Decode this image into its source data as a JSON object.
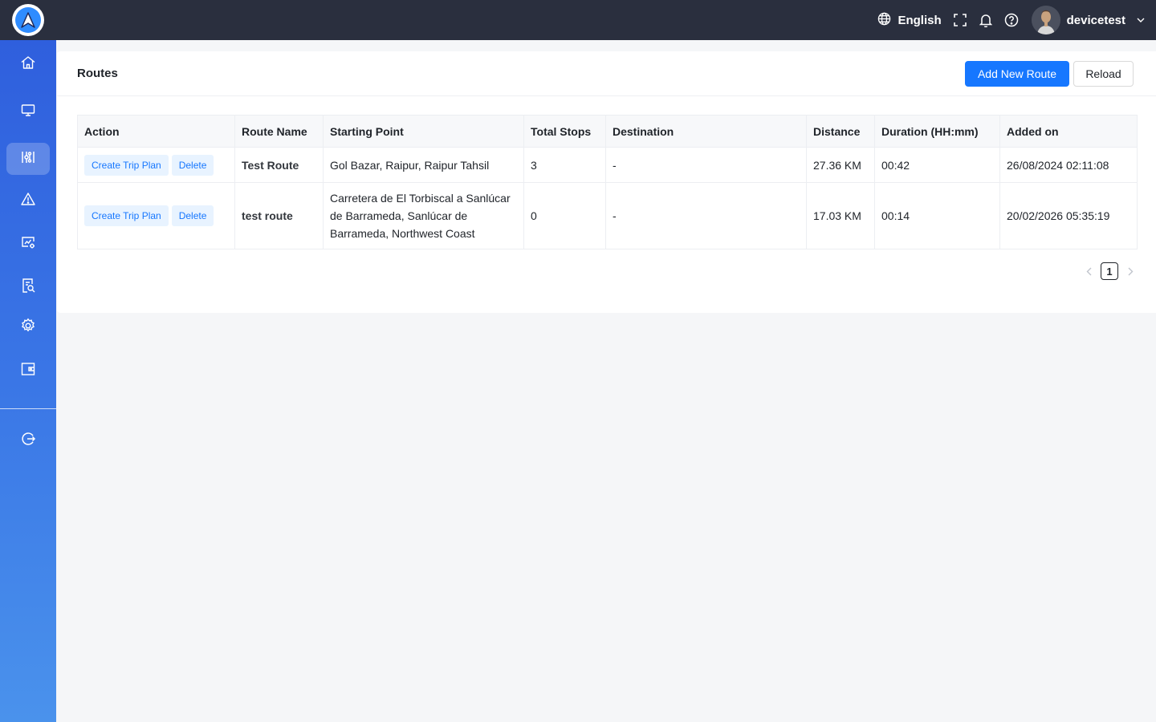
{
  "topbar": {
    "language": "English",
    "username": "devicetest"
  },
  "sidebar": {
    "items": [
      {
        "icon": "home-icon"
      },
      {
        "icon": "monitor-icon"
      },
      {
        "icon": "route-icon",
        "active": true
      },
      {
        "icon": "alert-icon"
      },
      {
        "icon": "device-settings-icon"
      },
      {
        "icon": "report-search-icon"
      },
      {
        "icon": "gear-icon"
      },
      {
        "icon": "wallet-icon"
      },
      {
        "icon": "logout-icon"
      }
    ]
  },
  "page": {
    "title": "Routes",
    "add_button": "Add New Route",
    "reload_button": "Reload"
  },
  "table": {
    "columns": [
      "Action",
      "Route Name",
      "Starting Point",
      "Total Stops",
      "Destination",
      "Distance",
      "Duration (HH:mm)",
      "Added on"
    ],
    "rows": [
      {
        "actions": [
          "Create Trip Plan",
          "Delete"
        ],
        "route_name": "Test Route",
        "starting_point": "Gol Bazar, Raipur, Raipur Tahsil",
        "total_stops": "3",
        "destination": "-",
        "distance": "27.36 KM",
        "duration": "00:42",
        "added_on": "26/08/2024 02:11:08"
      },
      {
        "actions": [
          "Create Trip Plan",
          "Delete"
        ],
        "route_name": "test route",
        "starting_point": "Carretera de El Torbiscal a Sanlúcar de Barrameda, Sanlúcar de Barrameda, Northwest Coast",
        "total_stops": "0",
        "destination": "-",
        "distance": "17.03 KM",
        "duration": "00:14",
        "added_on": "20/02/2026 05:35:19"
      }
    ]
  },
  "pagination": {
    "current_page": "1"
  }
}
